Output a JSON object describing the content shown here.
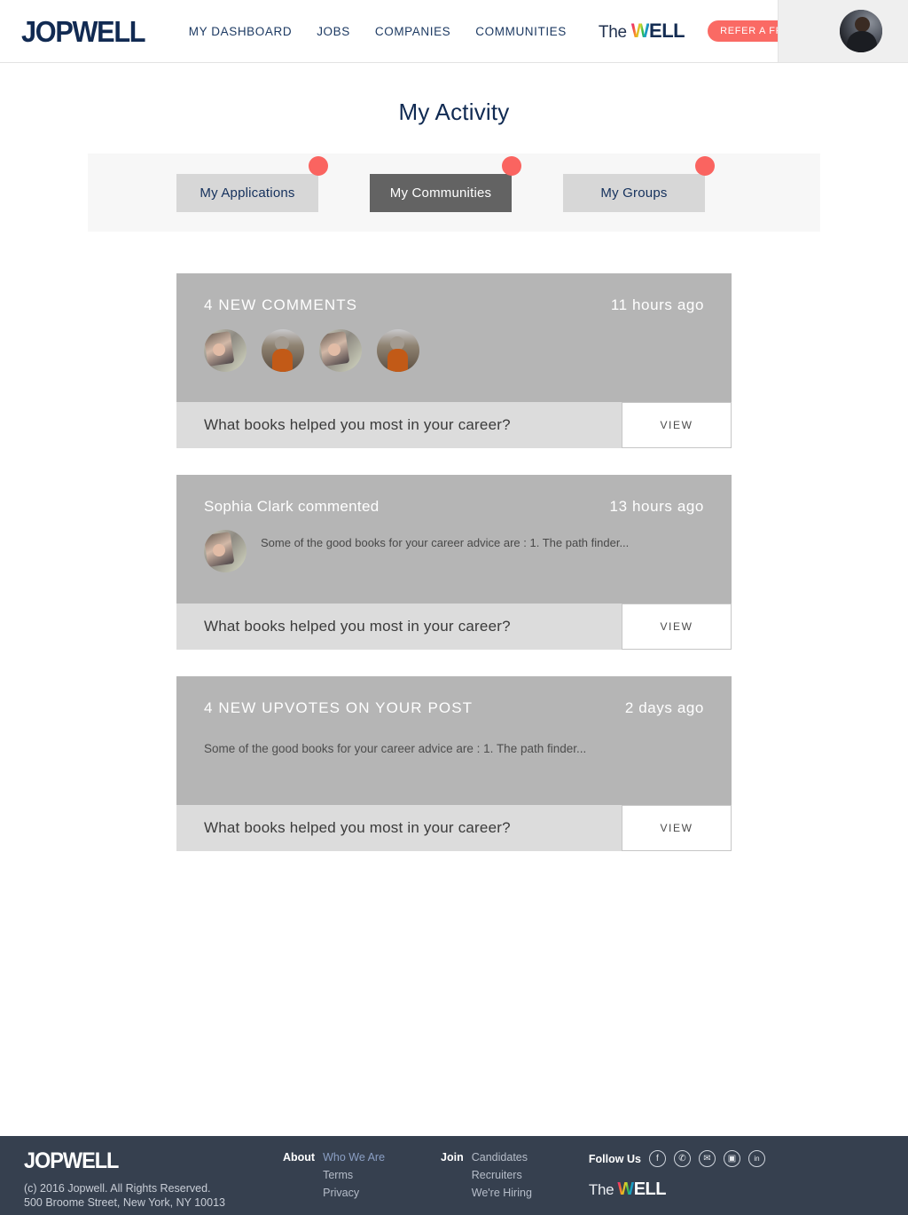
{
  "header": {
    "logo": "JOPWELL",
    "nav": [
      {
        "label": "MY DASHBOARD"
      },
      {
        "label": "JOBS"
      },
      {
        "label": "COMPANIES"
      },
      {
        "label": "COMMUNITIES"
      }
    ],
    "well_the": "The",
    "well_w": "W",
    "well_ell": "ELL",
    "refer_label": "REFER A FRIEND",
    "avatar_name": "user-avatar",
    "accent_color": "#fa6a64",
    "brand_color": "#112a52"
  },
  "page": {
    "title": "My Activity"
  },
  "tabs": [
    {
      "label": "My Applications",
      "active": false,
      "badge": ""
    },
    {
      "label": "My Communities",
      "active": true,
      "badge": ""
    },
    {
      "label": "My Groups",
      "active": false,
      "badge": ""
    }
  ],
  "cards": [
    {
      "title": "4 NEW COMMENTS",
      "time": "11 hours ago",
      "type": "comments",
      "avatar_count": 4,
      "question": "What books helped you most in your career?",
      "view_label": "VIEW"
    },
    {
      "title": "Sophia Clark commented",
      "time": "13 hours ago",
      "type": "comment",
      "body": "Some of the good books for your career advice are : 1. The path finder...",
      "question": "What books helped you most in your career?",
      "view_label": "VIEW"
    },
    {
      "title": "4 NEW UPVOTES ON YOUR POST",
      "time": "2 days ago",
      "type": "upvotes",
      "body": "Some of the good books for your career advice are : 1. The path finder...",
      "question": "What books helped you most in your career?",
      "view_label": "VIEW"
    }
  ],
  "footer": {
    "logo": "JOPWELL",
    "copyright_line1": "(c) 2016 Jopwell. All Rights Reserved.",
    "copyright_line2": "500 Broome Street, New York, NY 10013",
    "about_head": "About",
    "about_links": [
      {
        "label": "Who We Are"
      },
      {
        "label": "Terms"
      },
      {
        "label": "Privacy"
      }
    ],
    "join_head": "Join",
    "join_links": [
      {
        "label": "Candidates"
      },
      {
        "label": "Recruiters"
      },
      {
        "label": "We're Hiring"
      }
    ],
    "follow_head": "Follow Us",
    "social": [
      {
        "name": "facebook-icon",
        "glyph": "f"
      },
      {
        "name": "twitter-icon",
        "glyph": "✆"
      },
      {
        "name": "email-icon",
        "glyph": "✉"
      },
      {
        "name": "instagram-icon",
        "glyph": "▣"
      },
      {
        "name": "linkedin-icon",
        "glyph": "in"
      }
    ],
    "well_the": "The",
    "well_w": "W",
    "well_ell": "ELL",
    "bg_color": "#36404f"
  }
}
